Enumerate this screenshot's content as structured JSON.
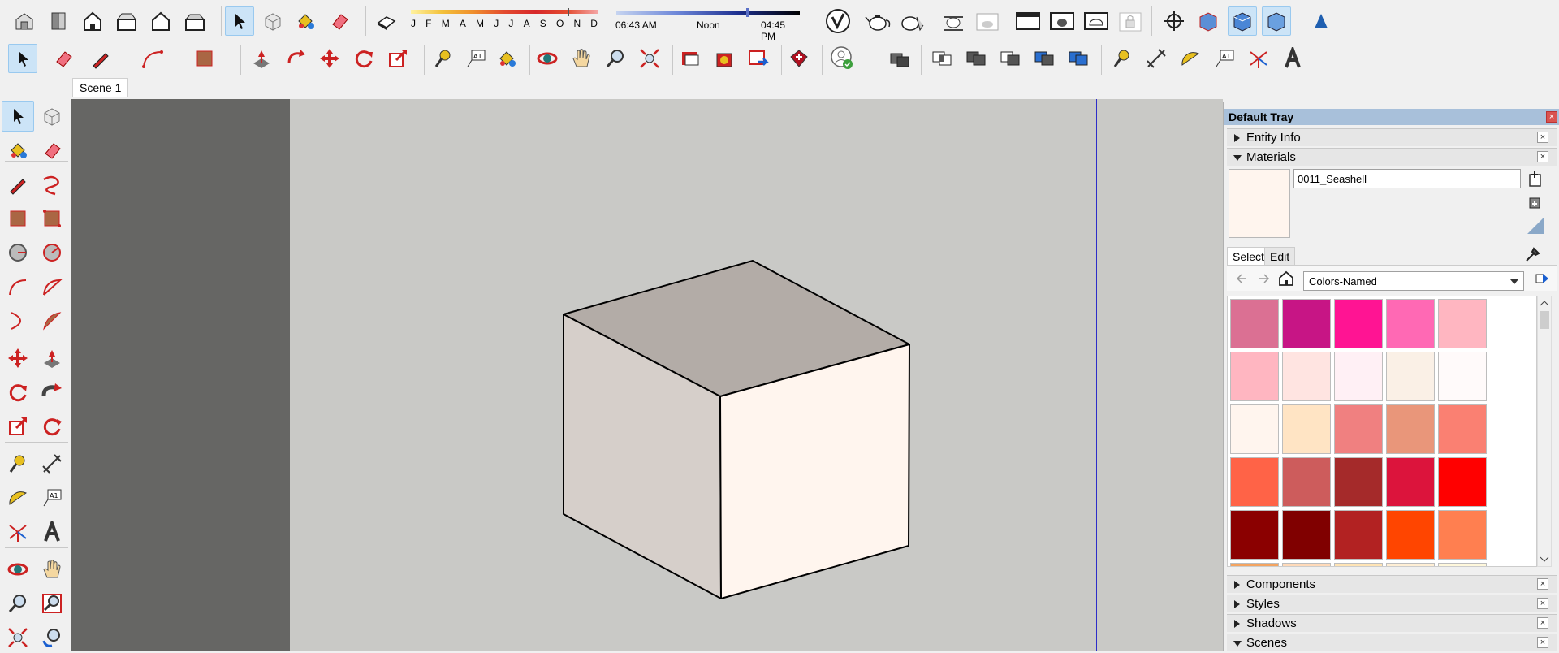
{
  "toolbar_top": {
    "shadow_months": [
      "J",
      "F",
      "M",
      "A",
      "M",
      "J",
      "J",
      "A",
      "S",
      "O",
      "N",
      "D"
    ],
    "time_start": "06:43 AM",
    "time_noon": "Noon",
    "time_end": "04:45 PM"
  },
  "scene_tab": {
    "label": "Scene 1"
  },
  "tray": {
    "title": "Default Tray",
    "entity_info_label": "Entity Info",
    "materials_label": "Materials",
    "material_name": "0011_Seashell",
    "tab_select": "Select",
    "tab_edit": "Edit",
    "library": "Colors-Named",
    "swatches": [
      "#db7093",
      "#c71585",
      "#ff1493",
      "#ff69b4",
      "#ffb6c1",
      "#ffb6c1",
      "#ffe4e1",
      "#fff0f5",
      "#faf0e6",
      "#fffafa",
      "#fff5ee",
      "#ffe4c4",
      "#f08080",
      "#e9967a",
      "#fa8072",
      "#ff6347",
      "#cd5c5c",
      "#a52a2a",
      "#dc143c",
      "#ff0000",
      "#8b0000",
      "#800000",
      "#b22222",
      "#ff4500",
      "#ff7f50",
      "#f4a460",
      "#ffdab9",
      "#ffe4b5",
      "#ffefd5",
      "#fff8dc"
    ],
    "components_label": "Components",
    "styles_label": "Styles",
    "shadows_label": "Shadows",
    "scenes_label": "Scenes"
  },
  "colors": {
    "viewport_bg": "#c9c9c6",
    "cube_top": "#b3aca7",
    "cube_left": "#d6cfca",
    "cube_right": "#fff5ee",
    "selection_highlight": "#cce4f7"
  }
}
